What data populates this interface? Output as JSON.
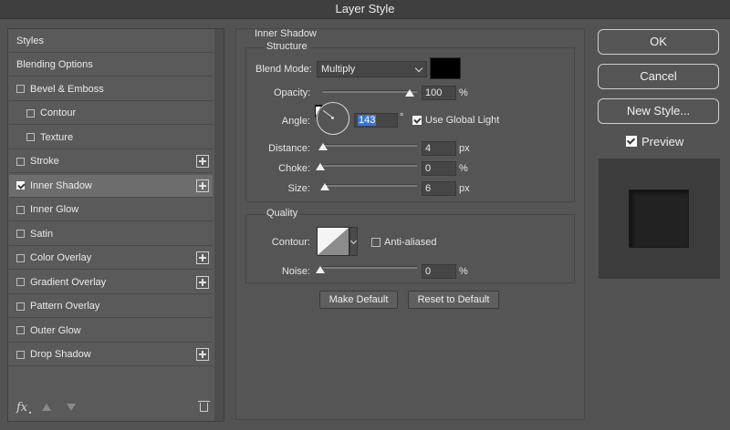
{
  "window": {
    "title": "Layer Style"
  },
  "styles_list": {
    "items": [
      {
        "label": "Styles",
        "checkbox": false,
        "checked": false,
        "plus": false,
        "sub": false,
        "active": false
      },
      {
        "label": "Blending Options",
        "checkbox": false,
        "checked": false,
        "plus": false,
        "sub": false,
        "active": false
      },
      {
        "label": "Bevel & Emboss",
        "checkbox": true,
        "checked": false,
        "plus": false,
        "sub": false,
        "active": false
      },
      {
        "label": "Contour",
        "checkbox": true,
        "checked": false,
        "plus": false,
        "sub": true,
        "active": false
      },
      {
        "label": "Texture",
        "checkbox": true,
        "checked": false,
        "plus": false,
        "sub": true,
        "active": false
      },
      {
        "label": "Stroke",
        "checkbox": true,
        "checked": false,
        "plus": true,
        "sub": false,
        "active": false
      },
      {
        "label": "Inner Shadow",
        "checkbox": true,
        "checked": true,
        "plus": true,
        "sub": false,
        "active": true
      },
      {
        "label": "Inner Glow",
        "checkbox": true,
        "checked": false,
        "plus": false,
        "sub": false,
        "active": false
      },
      {
        "label": "Satin",
        "checkbox": true,
        "checked": false,
        "plus": false,
        "sub": false,
        "active": false
      },
      {
        "label": "Color Overlay",
        "checkbox": true,
        "checked": false,
        "plus": true,
        "sub": false,
        "active": false
      },
      {
        "label": "Gradient Overlay",
        "checkbox": true,
        "checked": false,
        "plus": true,
        "sub": false,
        "active": false
      },
      {
        "label": "Pattern Overlay",
        "checkbox": true,
        "checked": false,
        "plus": false,
        "sub": false,
        "active": false
      },
      {
        "label": "Outer Glow",
        "checkbox": true,
        "checked": false,
        "plus": false,
        "sub": false,
        "active": false
      },
      {
        "label": "Drop Shadow",
        "checkbox": true,
        "checked": false,
        "plus": true,
        "sub": false,
        "active": false
      }
    ],
    "footer_icons": [
      "fx-icon",
      "move-up-icon",
      "move-down-icon",
      "trash-icon"
    ],
    "fx_label": "fx"
  },
  "inner_shadow": {
    "title": "Inner Shadow",
    "structure": {
      "title": "Structure",
      "blend_mode_label": "Blend Mode:",
      "blend_mode_value": "Multiply",
      "shadow_color": "#000000",
      "opacity_label": "Opacity:",
      "opacity_value": "100",
      "opacity_unit": "%",
      "angle_label": "Angle:",
      "angle_value": "143",
      "angle_unit": "°",
      "use_global_light_label": "Use Global Light",
      "use_global_light_checked": true,
      "distance_label": "Distance:",
      "distance_value": "4",
      "distance_unit": "px",
      "choke_label": "Choke:",
      "choke_value": "0",
      "choke_unit": "%",
      "size_label": "Size:",
      "size_value": "6",
      "size_unit": "px"
    },
    "quality": {
      "title": "Quality",
      "contour_label": "Contour:",
      "anti_aliased_label": "Anti-aliased",
      "anti_aliased_checked": false,
      "noise_label": "Noise:",
      "noise_value": "0",
      "noise_unit": "%"
    },
    "make_default_label": "Make Default",
    "reset_default_label": "Reset to Default"
  },
  "actions": {
    "ok_label": "OK",
    "cancel_label": "Cancel",
    "new_style_label": "New Style...",
    "preview_label": "Preview",
    "preview_checked": true
  }
}
